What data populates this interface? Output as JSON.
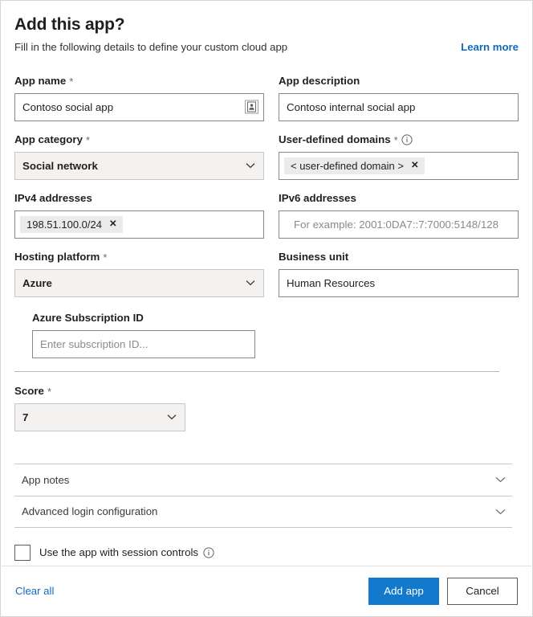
{
  "header": {
    "title": "Add this app?",
    "subtitle": "Fill in the following details to define your custom cloud app",
    "learn_more": "Learn more"
  },
  "fields": {
    "app_name": {
      "label": "App name",
      "required": "*",
      "value": "Contoso social app",
      "icon": "contact-card-icon"
    },
    "app_description": {
      "label": "App description",
      "value": "Contoso internal social app"
    },
    "app_category": {
      "label": "App category",
      "required": "*",
      "value": "Social network"
    },
    "user_defined_domains": {
      "label": "User-defined domains",
      "required": "*",
      "info": "info-icon",
      "tags": [
        "< user-defined domain >"
      ],
      "tag_remove": "✕"
    },
    "ipv4_addresses": {
      "label": "IPv4 addresses",
      "tags": [
        "198.51.100.0/24"
      ],
      "tag_remove": "✕"
    },
    "ipv6_addresses": {
      "label": "IPv6 addresses",
      "placeholder": "For example: 2001:0DA7::7:7000:5148/128",
      "value": ""
    },
    "hosting_platform": {
      "label": "Hosting platform",
      "required": "*",
      "value": "Azure"
    },
    "business_unit": {
      "label": "Business unit",
      "value": "Human Resources"
    },
    "azure_subscription_id": {
      "label": "Azure Subscription ID",
      "placeholder": "Enter subscription ID...",
      "value": ""
    },
    "score": {
      "label": "Score",
      "required": "*",
      "value": "7"
    }
  },
  "accordions": [
    {
      "label": "App notes"
    },
    {
      "label": "Advanced login configuration"
    }
  ],
  "session_controls": {
    "label": "Use the app with session controls",
    "checked": false,
    "info": "info-icon"
  },
  "footer": {
    "clear_all": "Clear all",
    "add_app": "Add app",
    "cancel": "Cancel"
  },
  "colors": {
    "accent": "#1379cd",
    "link": "#0f6cbd",
    "tag_bg": "#ebebeb",
    "select_bg": "#f3f2f1",
    "border": "#8a8886"
  }
}
